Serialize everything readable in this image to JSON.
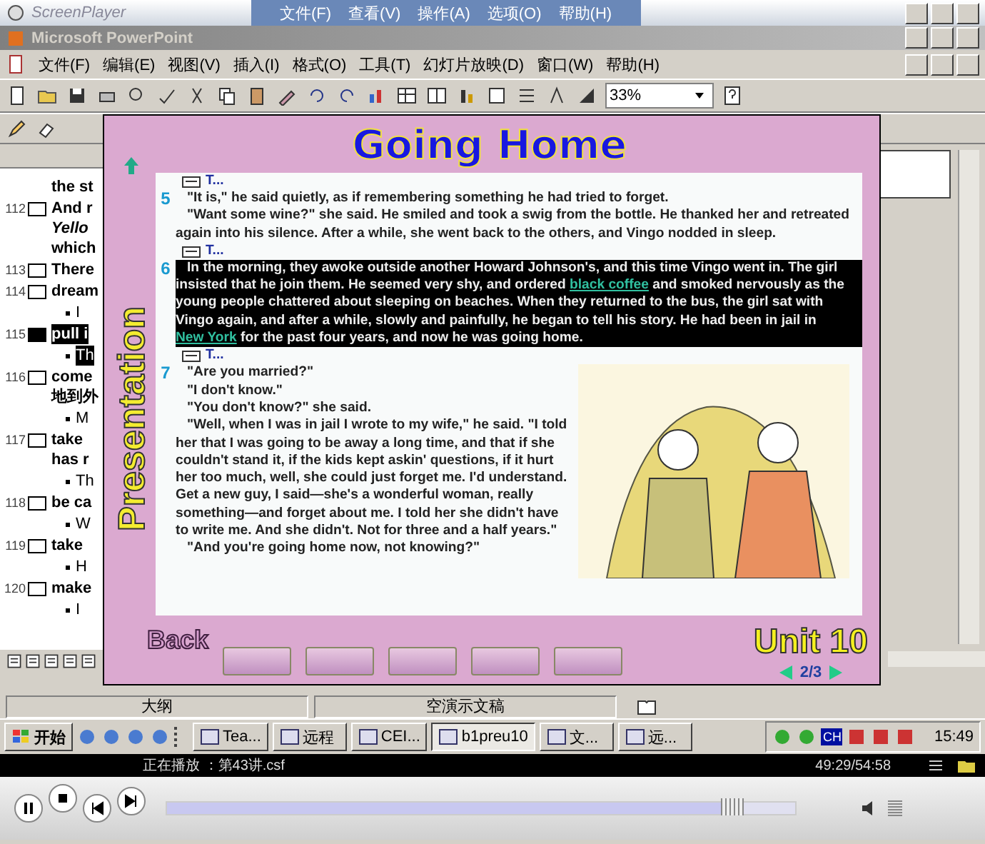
{
  "player": {
    "title": "ScreenPlayer",
    "menu": [
      {
        "label": "文件(F)"
      },
      {
        "label": "查看(V)"
      },
      {
        "label": "操作(A)"
      },
      {
        "label": "选项(O)"
      },
      {
        "label": "帮助(H)"
      }
    ]
  },
  "app": {
    "title": "Microsoft PowerPoint",
    "menu": [
      {
        "label": "文件(F)"
      },
      {
        "label": "编辑(E)"
      },
      {
        "label": "视图(V)"
      },
      {
        "label": "插入(I)"
      },
      {
        "label": "格式(O)"
      },
      {
        "label": "工具(T)"
      },
      {
        "label": "幻灯片放映(D)"
      },
      {
        "label": "窗口(W)"
      },
      {
        "label": "帮助(H)"
      }
    ],
    "zoom": "33%"
  },
  "outline": [
    {
      "lines": [
        "the st"
      ],
      "selected": false
    },
    {
      "number": "112",
      "lines": [
        "And r",
        "*Yello*",
        "which"
      ],
      "selected": false
    },
    {
      "number": "113",
      "lines": [
        "There"
      ],
      "selected": false
    },
    {
      "number": "114",
      "lines": [
        "dream"
      ],
      "selected": false,
      "children": [
        {
          "text": "I"
        }
      ]
    },
    {
      "number": "115",
      "lines": [
        "pull i"
      ],
      "selected": true,
      "children": [
        {
          "text": "Th"
        }
      ]
    },
    {
      "number": "116",
      "lines": [
        "come",
        "地到外"
      ],
      "selected": false,
      "children": [
        {
          "text": "M"
        }
      ]
    },
    {
      "number": "117",
      "lines": [
        "take",
        "has r"
      ],
      "selected": false,
      "children": [
        {
          "text": "Th"
        }
      ]
    },
    {
      "number": "118",
      "lines": [
        "be ca"
      ],
      "selected": false,
      "children": [
        {
          "text": "W"
        }
      ]
    },
    {
      "number": "119",
      "lines": [
        "take"
      ],
      "selected": false,
      "children": [
        {
          "text": "H"
        }
      ]
    },
    {
      "number": "120",
      "lines": [
        "make"
      ],
      "selected": false,
      "children": [
        {
          "text": "I"
        }
      ]
    }
  ],
  "slide": {
    "title": "Going Home",
    "side_title": "Presentation",
    "paragraphs": [
      {
        "number": "5",
        "heading": "T...",
        "selected": false,
        "lines": [
          [
            {
              "kind": "text",
              "text": "\"It is,\" he said quietly, as if remembering something he had tried to forget."
            }
          ],
          [
            {
              "kind": "text",
              "text": "\"Want some wine?\" she said. He smiled and took a swig from the bottle. He thanked her and retreated again into his silence.  After a while, she went back to the others, and Vingo nodded in sleep."
            }
          ]
        ]
      },
      {
        "number": "6",
        "heading": "T...",
        "selected": true,
        "lines": [
          [
            {
              "kind": "text",
              "text": "In the morning, they awoke outside another Howard Johnson's, and this time Vingo went in. The girl insisted that he join them. He seemed very shy, and ordered "
            },
            {
              "kind": "link",
              "text": "black coffee"
            },
            {
              "kind": "text",
              "text": " and smoked nervously as the young people chattered about sleeping on beaches. When they returned to the bus, the girl sat with Vingo again, and after a while, slowly and painfully, he began to tell his story. He had been in jail in "
            },
            {
              "kind": "link",
              "text": "New York"
            },
            {
              "kind": "text",
              "text": " for the past four years, and now he was going home."
            }
          ]
        ]
      },
      {
        "number": "7",
        "heading": "T...",
        "selected": false,
        "lines": [
          [
            {
              "kind": "text",
              "text": "\"Are you married?\""
            }
          ],
          [
            {
              "kind": "text",
              "text": "\"I don't know.\""
            }
          ],
          [
            {
              "kind": "text",
              "text": "\"You don't know?\" she said."
            }
          ],
          [
            {
              "kind": "text",
              "text": "\"Well, when I was in jail I wrote to my wife,\"  he said. \"I told her that I was going to be away a long time, and that if she couldn't stand it, if the kids kept askin' questions, if it hurt her too much, well, she could just forget me. I'd understand. Get a new guy, I said—she's a wonderful woman, really something—and forget about me. I told her she didn't have to write me. And she didn't. Not for three and a half years.\""
            }
          ],
          [
            {
              "kind": "text",
              "text": "\"And you're going home now, not knowing?\""
            }
          ]
        ]
      }
    ],
    "back": "Back",
    "unit": "Unit 10",
    "page": "2/3"
  },
  "status_bar": [
    {
      "text": "大纲"
    },
    {
      "text": "空演示文稿"
    }
  ],
  "taskbar": {
    "start": "开始",
    "tasks": [
      {
        "label": "Tea...",
        "selected": false
      },
      {
        "label": "远程",
        "selected": false
      },
      {
        "label": "CEI...",
        "selected": false
      },
      {
        "label": "b1preu10",
        "selected": true
      },
      {
        "label": "文...",
        "selected": false
      },
      {
        "label": "远...",
        "selected": false
      }
    ],
    "tray_lang": "CH",
    "clock": "15:49"
  },
  "playback": {
    "status": "正在播放 ：第43讲.csf",
    "time": "49:29/54:58",
    "level": 0.9
  }
}
